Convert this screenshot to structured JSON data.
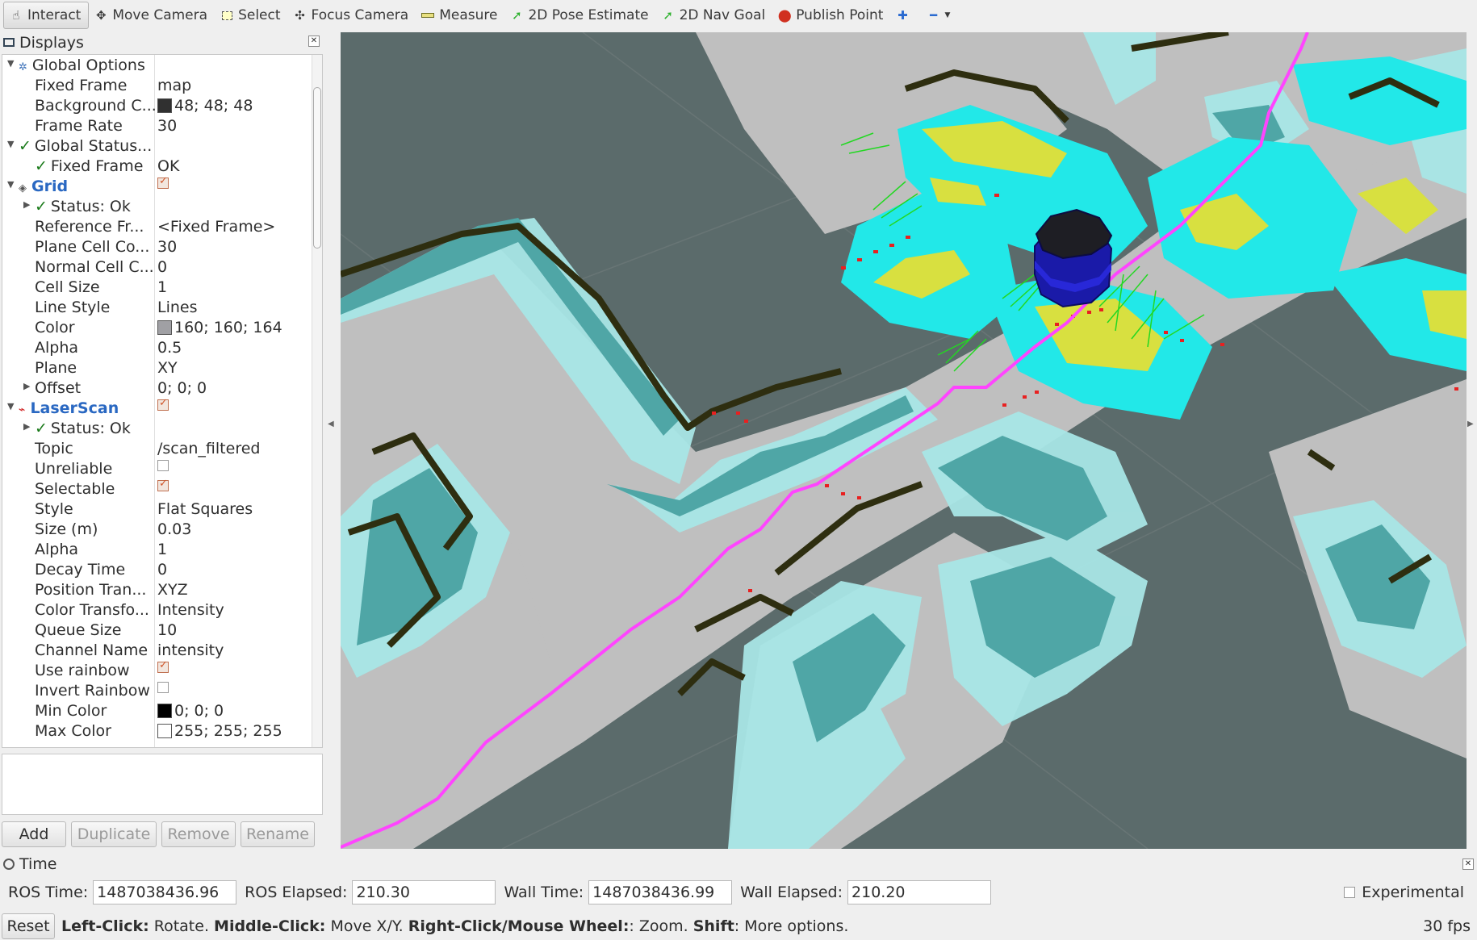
{
  "toolbar": {
    "tools": [
      {
        "name": "interact",
        "label": "Interact",
        "icon": "hand-icon",
        "active": true
      },
      {
        "name": "move-camera",
        "label": "Move Camera",
        "icon": "move-icon"
      },
      {
        "name": "select",
        "label": "Select",
        "icon": "select-box-icon"
      },
      {
        "name": "focus-camera",
        "label": "Focus Camera",
        "icon": "focus-icon"
      },
      {
        "name": "measure",
        "label": "Measure",
        "icon": "ruler-icon"
      },
      {
        "name": "2d-pose-estimate",
        "label": "2D Pose Estimate",
        "icon": "green-arrow-icon"
      },
      {
        "name": "2d-nav-goal",
        "label": "2D Nav Goal",
        "icon": "green-arrow-icon"
      },
      {
        "name": "publish-point",
        "label": "Publish Point",
        "icon": "map-pin-icon"
      }
    ]
  },
  "displays": {
    "title": "Displays",
    "rows": [
      {
        "label": "Global Options",
        "value": ""
      },
      {
        "label": "Fixed Frame",
        "value": "map"
      },
      {
        "label": "Background C...",
        "value": "48; 48; 48"
      },
      {
        "label": "Frame Rate",
        "value": "30"
      },
      {
        "label": "Global Status...",
        "value": ""
      },
      {
        "label": "Fixed Frame",
        "value": "OK"
      },
      {
        "label": "Grid",
        "value": ""
      },
      {
        "label": "Status: Ok",
        "value": ""
      },
      {
        "label": "Reference Fr...",
        "value": "<Fixed Frame>"
      },
      {
        "label": "Plane Cell Co...",
        "value": "30"
      },
      {
        "label": "Normal Cell C...",
        "value": "0"
      },
      {
        "label": "Cell Size",
        "value": "1"
      },
      {
        "label": "Line Style",
        "value": "Lines"
      },
      {
        "label": "Color",
        "value": "160; 160; 164"
      },
      {
        "label": "Alpha",
        "value": "0.5"
      },
      {
        "label": "Plane",
        "value": "XY"
      },
      {
        "label": "Offset",
        "value": "0; 0; 0"
      },
      {
        "label": "LaserScan",
        "value": ""
      },
      {
        "label": "Status: Ok",
        "value": ""
      },
      {
        "label": "Topic",
        "value": "/scan_filtered"
      },
      {
        "label": "Unreliable",
        "value": ""
      },
      {
        "label": "Selectable",
        "value": ""
      },
      {
        "label": "Style",
        "value": "Flat Squares"
      },
      {
        "label": "Size (m)",
        "value": "0.03"
      },
      {
        "label": "Alpha",
        "value": "1"
      },
      {
        "label": "Decay Time",
        "value": "0"
      },
      {
        "label": "Position Tran...",
        "value": "XYZ"
      },
      {
        "label": "Color Transfo...",
        "value": "Intensity"
      },
      {
        "label": "Queue Size",
        "value": "10"
      },
      {
        "label": "Channel Name",
        "value": "intensity"
      },
      {
        "label": "Use rainbow",
        "value": ""
      },
      {
        "label": "Invert Rainbow",
        "value": ""
      },
      {
        "label": "Min Color",
        "value": "0; 0; 0"
      },
      {
        "label": "Max Color",
        "value": "255; 255; 255"
      }
    ],
    "buttons": {
      "add": "Add",
      "duplicate": "Duplicate",
      "remove": "Remove",
      "rename": "Rename"
    }
  },
  "colors": {
    "background": "#303030",
    "grid": "#a0a0a4",
    "path": "#ff44ff",
    "costmap": "#22e8e8",
    "robot": "#1a1aa8"
  },
  "time": {
    "title": "Time",
    "ros_time_label": "ROS Time:",
    "ros_time": "1487038436.96",
    "ros_elapsed_label": "ROS Elapsed:",
    "ros_elapsed": "210.30",
    "wall_time_label": "Wall Time:",
    "wall_time": "1487038436.99",
    "wall_elapsed_label": "Wall Elapsed:",
    "wall_elapsed": "210.20",
    "experimental": "Experimental"
  },
  "status": {
    "reset": "Reset",
    "left_click": "Left-Click:",
    "left_click_text": " Rotate. ",
    "middle_click": "Middle-Click:",
    "middle_click_text": " Move X/Y. ",
    "right_click": "Right-Click/Mouse Wheel:",
    "right_click_text": ": Zoom. ",
    "shift": "Shift",
    "shift_text": ": More options.",
    "fps": "30 fps"
  }
}
